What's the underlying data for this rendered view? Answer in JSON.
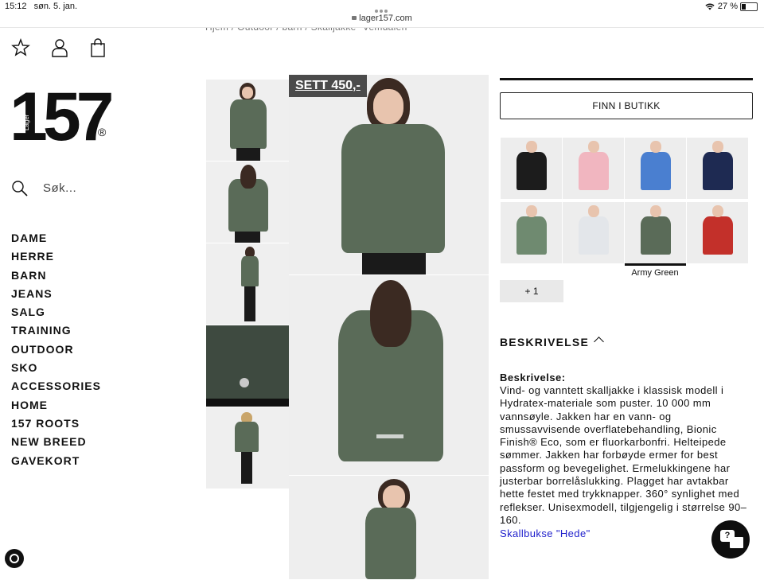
{
  "status_bar": {
    "time": "15:12",
    "date": "søn. 5. jan.",
    "url": "lager157.com",
    "battery": "27 %"
  },
  "breadcrumb": "Hjem / Outdoor / barn / Skalljakke \"Vemdalen\"",
  "header_icons": [
    "star-icon",
    "user-icon",
    "bag-icon"
  ],
  "logo": {
    "number": "157",
    "word": "Lager",
    "mark": "®"
  },
  "search": {
    "placeholder": "Søk..."
  },
  "nav": [
    "DAME",
    "HERRE",
    "BARN",
    "JEANS",
    "SALG",
    "TRAINING",
    "OUTDOOR",
    "SKO",
    "ACCESSORIES",
    "HOME",
    "157 ROOTS",
    "NEW BREED",
    "GAVEKORT"
  ],
  "product": {
    "badge": "SETT 450,-",
    "store_button": "FINN I BUTIKK",
    "selected_color": "Army Green",
    "more_button": "+ 1",
    "color_swatches": [
      "#1c1c1c",
      "#f1b6c0",
      "#4a7fd0",
      "#1e2a52",
      "#6f8a70",
      "#e3e6ea",
      "#5a6b58",
      "#c3302a"
    ],
    "description_heading": "BESKRIVELSE",
    "description_title": "Beskrivelse:",
    "description_text": "Vind- og vanntett skalljakke i klassisk modell i Hydratex-materiale som puster. 10 000 mm vannsøyle. Jakken har en vann- og smussavvisende overflatebehandling, Bionic Finish® Eco, som er fluorkarbonfri. Helteipede sømmer. Jakken har forbøyde ermer for best passform og bevegelighet. Ermelukkingene har justerbar borrelåslukking. Plagget har avtakbar hette festet med trykknapper. 360° synlighet med reflekser. Unisexmodell, tilgjengelig i størrelse 90–160.",
    "related_link": "Skallbukse \"Hede\""
  },
  "chat_icon": "chat-help-icon"
}
